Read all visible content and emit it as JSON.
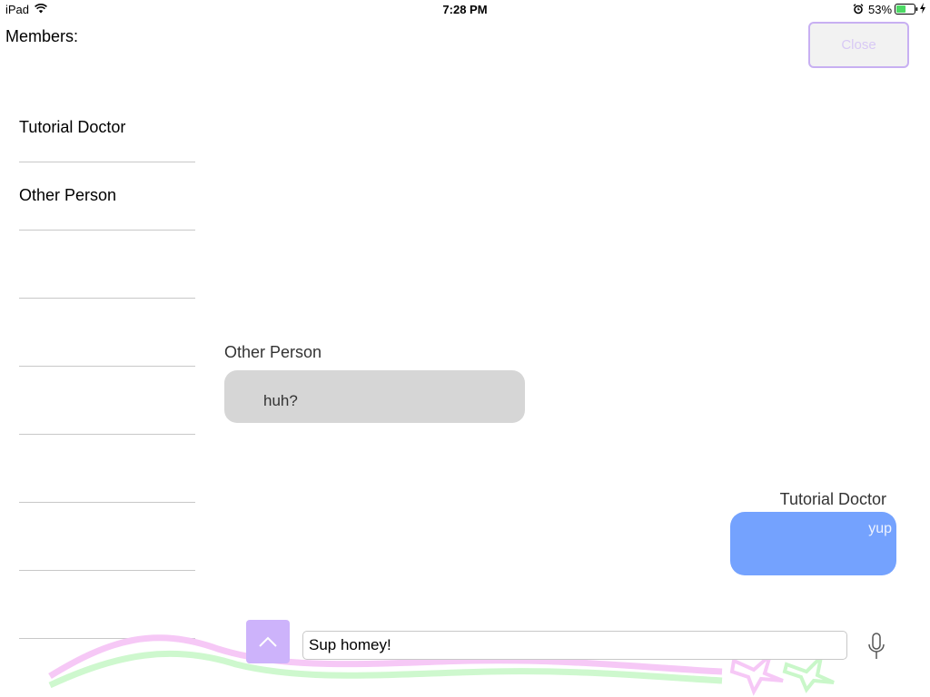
{
  "status_bar": {
    "device": "iPad",
    "time": "7:28 PM",
    "battery_percent": "53%",
    "battery_level": 0.53,
    "icons": [
      "wifi-icon",
      "alarm-icon",
      "battery-icon",
      "charging-icon"
    ]
  },
  "members": {
    "title": "Members:",
    "items": [
      "Tutorial Doctor",
      "Other Person",
      "",
      "",
      "",
      "",
      "",
      ""
    ]
  },
  "close_button": {
    "label": "Close"
  },
  "messages": [
    {
      "sender": "Other Person",
      "text": "huh?",
      "side": "left",
      "bubble_color": "#d6d6d6"
    },
    {
      "sender": "Tutorial Doctor",
      "text": "yup",
      "side": "right",
      "bubble_color": "#74a2fe"
    }
  ],
  "input_bar": {
    "value": "Sup homey!",
    "expand_icon": "chevron-up-icon",
    "mic_icon": "microphone-icon"
  },
  "colors": {
    "accent": "#cdb3fb",
    "outgoing_bubble": "#74a2fe",
    "incoming_bubble": "#d6d6d6"
  }
}
